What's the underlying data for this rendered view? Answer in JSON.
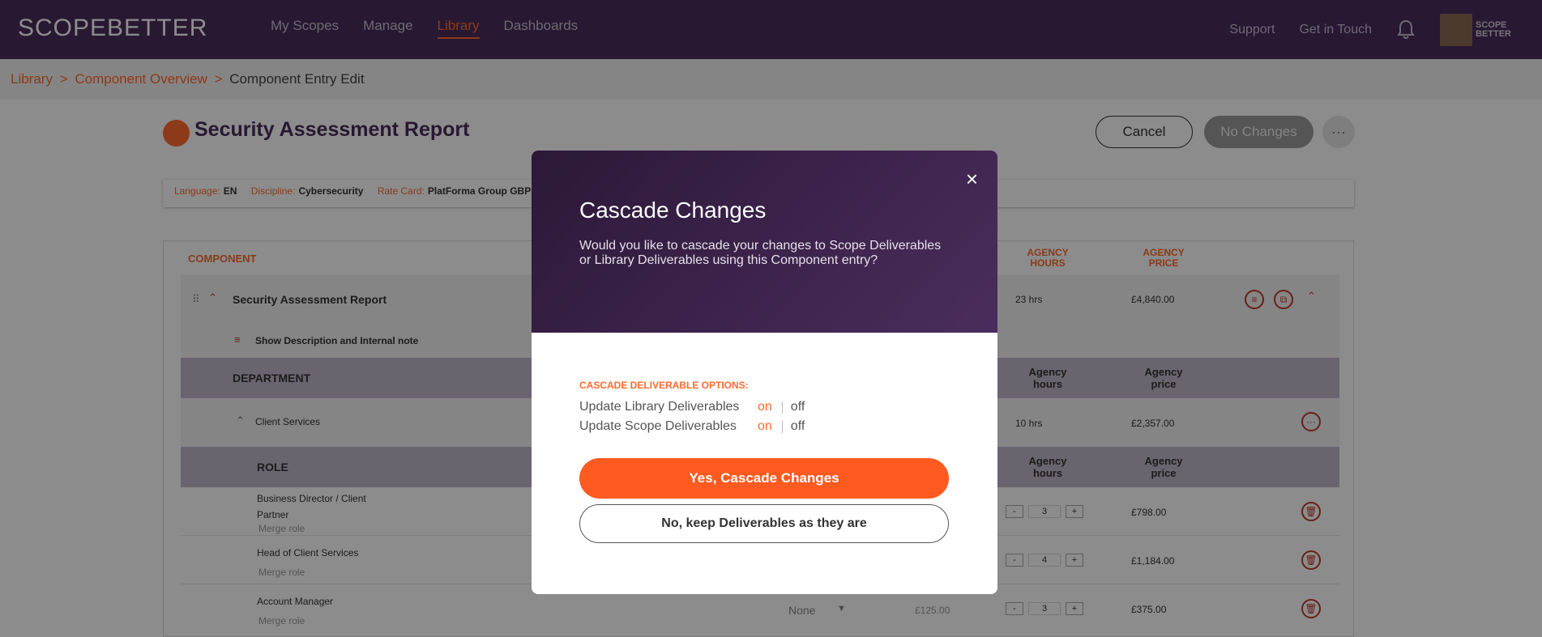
{
  "topbar": {
    "logo": "SCOPEBETTER",
    "nav": [
      "My Scopes",
      "Manage",
      "Library",
      "Dashboards"
    ],
    "active_nav": "Library",
    "support": "Support",
    "get_in_touch": "Get in Touch",
    "avatar_logo": "SCOPE BETTER"
  },
  "breadcrumb": {
    "items": [
      "Library",
      "Component Overview"
    ],
    "separator": ">",
    "current": "Component Entry Edit"
  },
  "page": {
    "title": "Security Assessment Report",
    "cancel_label": "Cancel",
    "no_changes_label": "No Changes",
    "more_label": "···"
  },
  "meta": {
    "language_key": "Language:",
    "language_val": "EN",
    "discipline_key": "Discipline:",
    "discipline_val": "Cybersecurity",
    "ratecard_key": "Rate Card:",
    "ratecard_val": "PlatForma Group GBP"
  },
  "table": {
    "header_component": "COMPONENT",
    "header_hours": "AGENCY HOURS",
    "header_price": "AGENCY PRICE",
    "component_name": "Security Assessment Report",
    "component_hours": "23 hrs",
    "component_price": "£4,840.00",
    "show_description": "Show Description and Internal note",
    "dept_header": "DEPARTMENT",
    "agency_hours_label": "Agency hours",
    "agency_price_label": "Agency price",
    "department": "Client Services",
    "dept_hours": "10 hrs",
    "dept_price": "£2,357.00",
    "role_header": "ROLE",
    "merge_role": "Merge role",
    "roles": [
      {
        "name": "Business Director / Client Partner",
        "qty": "3",
        "price": "£798.00"
      },
      {
        "name": "Head of Client Services",
        "qty": "4",
        "price": "£1,184.00"
      },
      {
        "name": "Account Manager",
        "qty": "3",
        "price": "£375.00",
        "select": "None",
        "rate": "£125.00"
      }
    ]
  },
  "modal": {
    "title": "Cascade Changes",
    "description": "Would you like to cascade your changes to Scope Deliverables or Library Deliverables using this Component entry?",
    "options_title": "CASCADE DELIVERABLE OPTIONS:",
    "options": [
      {
        "label": "Update Library Deliverables",
        "on": "on",
        "off": "off"
      },
      {
        "label": "Update Scope Deliverables",
        "on": "on",
        "off": "off"
      }
    ],
    "yes_label": "Yes, Cascade Changes",
    "no_label": "No, keep Deliverables as they are",
    "close_label": "×"
  },
  "colors": {
    "brand_purple": "#4a2d5c",
    "accent_orange": "#ff6a2e"
  }
}
